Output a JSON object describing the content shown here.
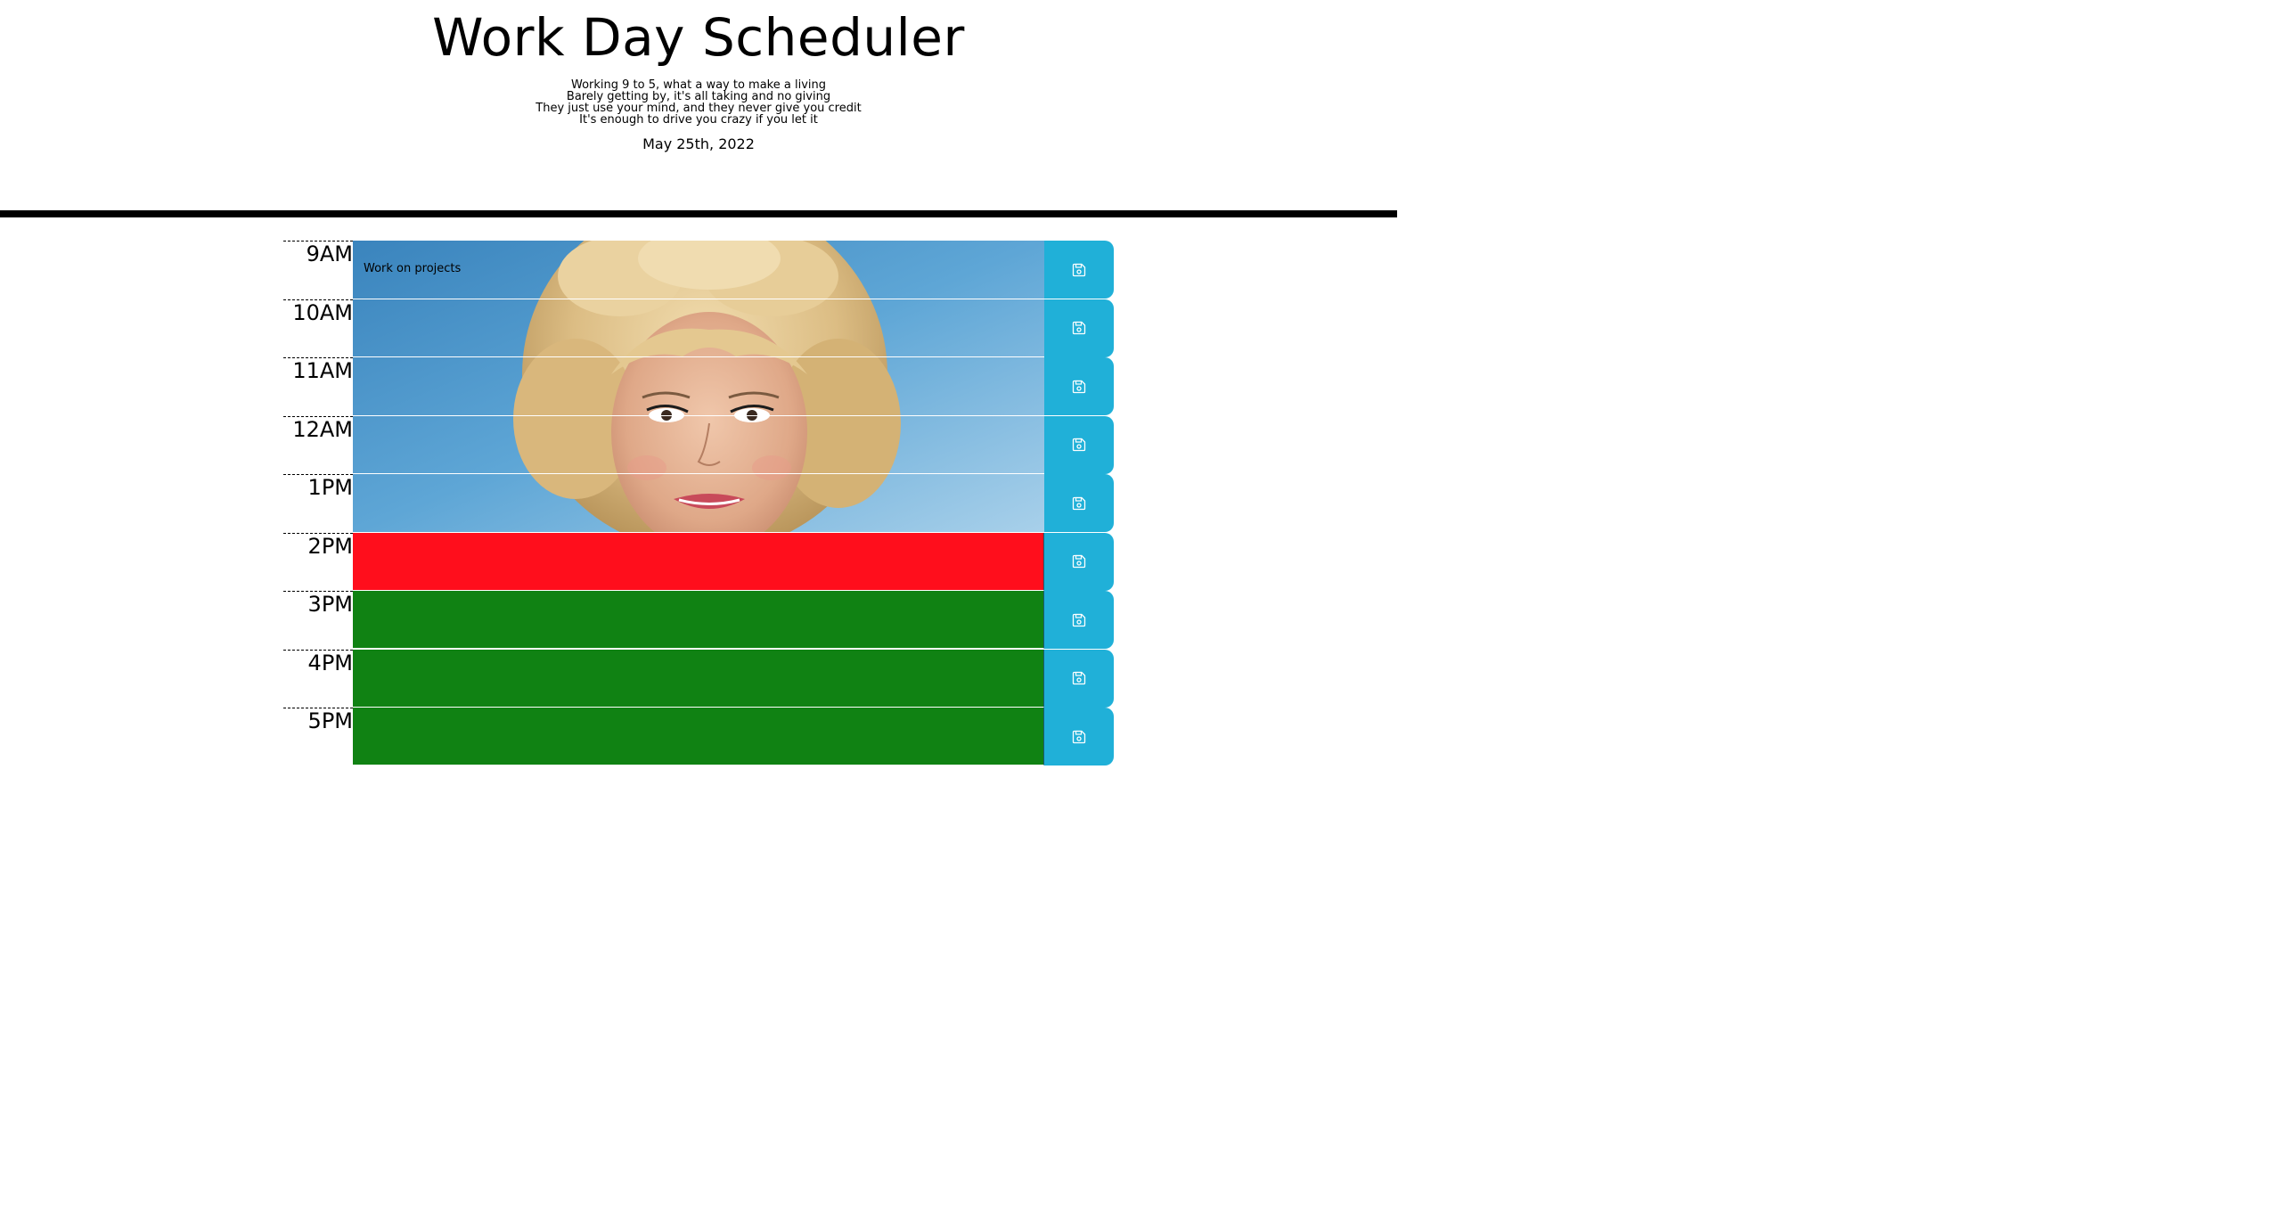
{
  "header": {
    "title": "Work Day Scheduler",
    "lyrics": [
      "Working 9 to 5, what a way to make a living",
      "Barely getting by, it's all taking and no giving",
      "They just use your mind, and they never give you credit",
      "It's enough to drive you crazy if you let it"
    ],
    "date": "May 25th, 2022"
  },
  "rows": [
    {
      "hour": "9AM",
      "text": "Work on projects",
      "status": "past"
    },
    {
      "hour": "10AM",
      "text": "",
      "status": "past"
    },
    {
      "hour": "11AM",
      "text": "",
      "status": "past"
    },
    {
      "hour": "12AM",
      "text": "",
      "status": "past"
    },
    {
      "hour": "1PM",
      "text": "",
      "status": "past"
    },
    {
      "hour": "2PM",
      "text": "",
      "status": "present"
    },
    {
      "hour": "3PM",
      "text": "",
      "status": "future"
    },
    {
      "hour": "4PM",
      "text": "",
      "status": "future"
    },
    {
      "hour": "5PM",
      "text": "",
      "status": "future"
    }
  ],
  "colors": {
    "save_button": "#20b0d8",
    "present": "#ff0e1c",
    "future": "#108213",
    "past_sky": "#5aa3d3"
  },
  "icons": {
    "save": "floppy-disk-icon"
  }
}
